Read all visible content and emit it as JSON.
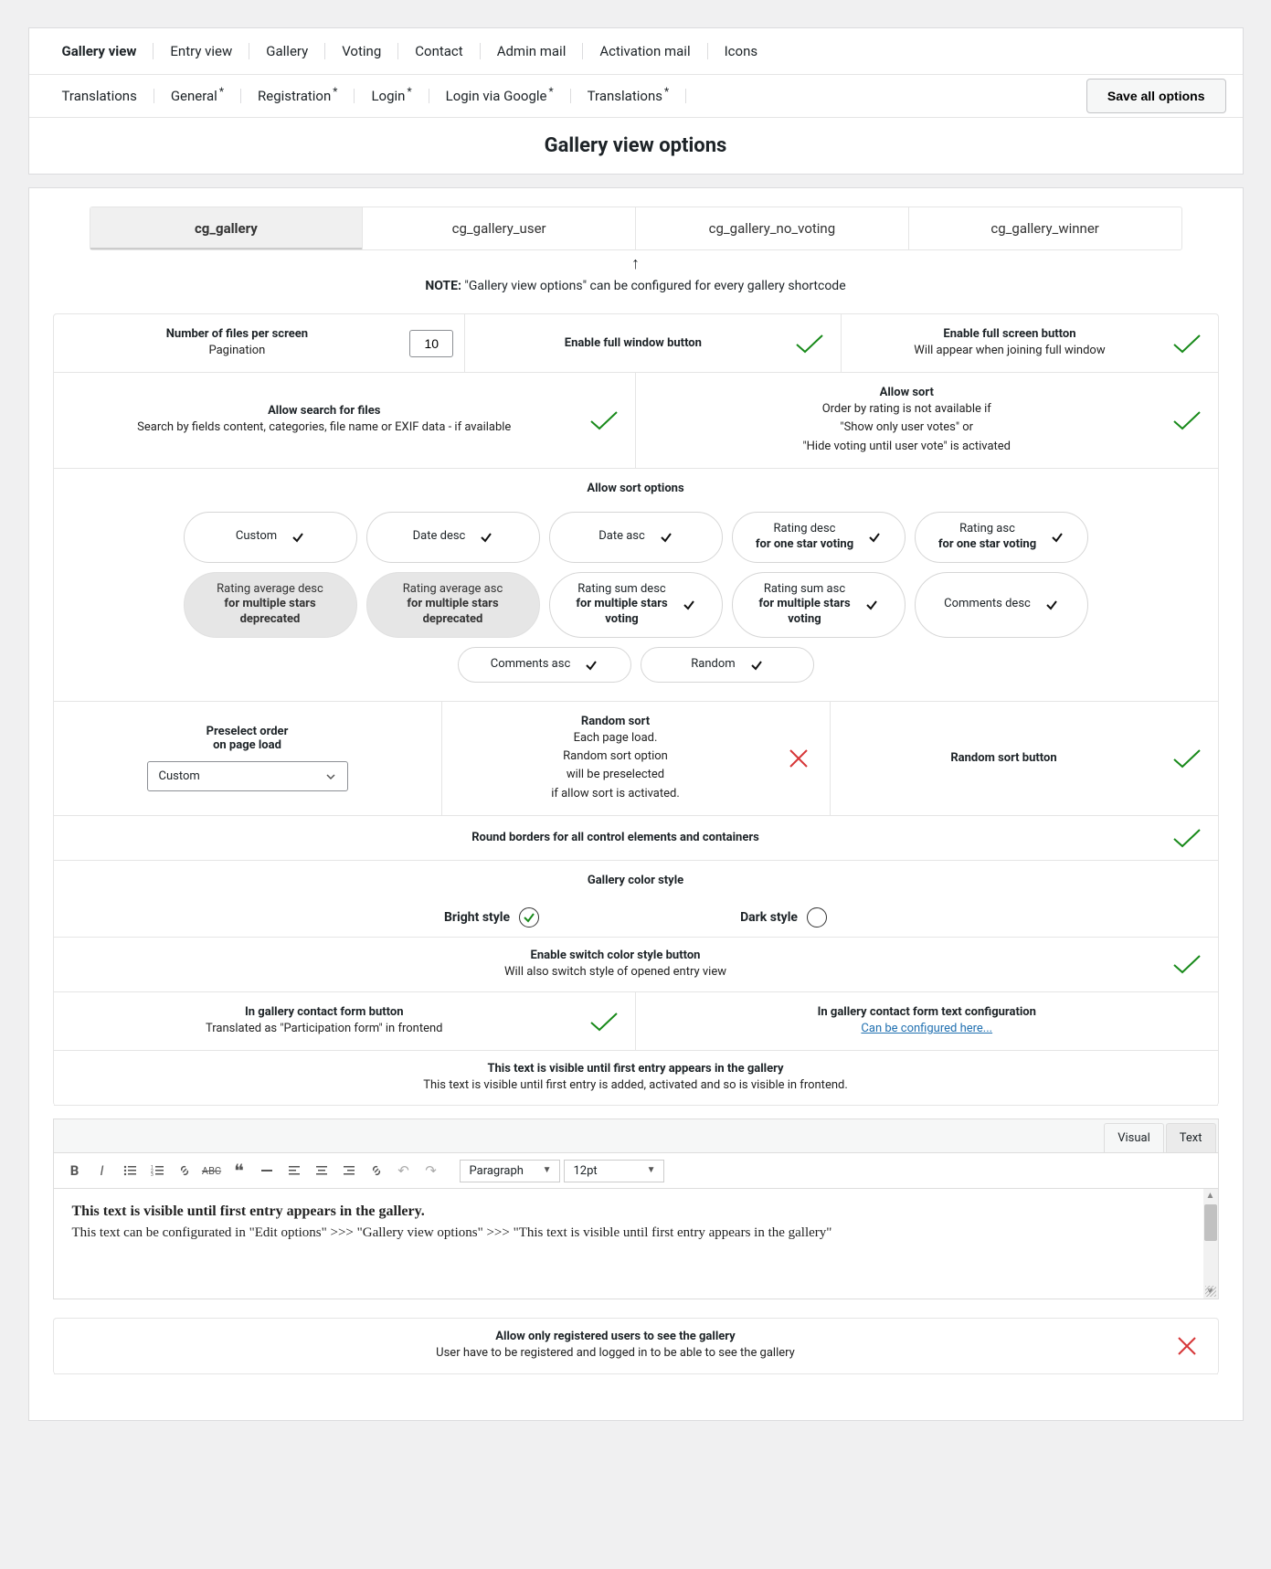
{
  "nav1": [
    "Gallery view",
    "Entry view",
    "Gallery",
    "Voting",
    "Contact",
    "Admin mail",
    "Activation mail",
    "Icons"
  ],
  "nav2": [
    "Translations",
    "General",
    "Registration",
    "Login",
    "Login via Google",
    "Translations"
  ],
  "nav2_starred": [
    false,
    true,
    true,
    true,
    true,
    true
  ],
  "save_all": "Save all options",
  "page_title": "Gallery view options",
  "shortcode_tabs": [
    "cg_gallery",
    "cg_gallery_user",
    "cg_gallery_no_voting",
    "cg_gallery_winner"
  ],
  "arrow": "↑",
  "note_bold": "NOTE:",
  "note_text": " \"Gallery view options\" can be configured for every gallery shortcode",
  "r1": {
    "files_per_screen": "Number of files per screen",
    "pagination": "Pagination",
    "value": "10",
    "full_window": "Enable full window button",
    "full_screen": "Enable full screen button",
    "full_screen_sub": "Will appear when joining full window"
  },
  "r2": {
    "search_lbl": "Allow search for files",
    "search_sub": "Search by fields content, categories, file name or EXIF data - if available",
    "sort_lbl": "Allow sort",
    "sort_sub1": "Order by rating is not available if",
    "sort_sub2": "\"Show only user votes\" or",
    "sort_sub3": "\"Hide voting until user vote\" is activated"
  },
  "sort_head": "Allow sort options",
  "pills": [
    {
      "l1": "Custom",
      "on": true
    },
    {
      "l1": "Date desc",
      "on": true
    },
    {
      "l1": "Date asc",
      "on": true
    },
    {
      "l1": "Rating desc",
      "l2": "for one star voting",
      "on": true
    },
    {
      "l1": "Rating asc",
      "l2": "for one star voting",
      "on": true
    },
    {
      "l1": "Rating average desc",
      "l2": "for multiple stars",
      "l3": "deprecated",
      "on": false
    },
    {
      "l1": "Rating average asc",
      "l2": "for multiple stars",
      "l3": "deprecated",
      "on": false
    },
    {
      "l1": "Rating sum desc",
      "l2": "for multiple stars",
      "l3": "voting",
      "on": true,
      "l2bold": true
    },
    {
      "l1": "Rating sum asc",
      "l2": "for multiple stars",
      "l3": "voting",
      "on": true,
      "l2bold": true
    },
    {
      "l1": "Comments desc",
      "on": true
    },
    {
      "l1": "Comments asc",
      "on": true
    },
    {
      "l1": "Random",
      "on": true
    }
  ],
  "r3": {
    "preselect1": "Preselect order",
    "preselect2": "on page load",
    "preselect_value": "Custom",
    "random_lbl": "Random sort",
    "random_s1": "Each page load.",
    "random_s2": "Random sort option",
    "random_s3": "will be preselected",
    "random_s4": "if allow sort is activated.",
    "random_btn": "Random sort button"
  },
  "round_borders": "Round borders for all control elements and containers",
  "color_style": "Gallery color style",
  "bright": "Bright style",
  "dark": "Dark style",
  "switch_lbl": "Enable switch color style button",
  "switch_sub": "Will also switch style of opened entry view",
  "contact_btn_lbl": "In gallery contact form button",
  "contact_btn_sub": "Translated as \"Participation form\" in frontend",
  "contact_cfg_lbl": "In gallery contact form text configuration",
  "contact_cfg_link": "Can be configured here...",
  "pretext_lbl": "This text is visible until first entry appears in the gallery",
  "pretext_sub": "This text is visible until first entry is added, activated and so is visible in frontend.",
  "editor": {
    "visual": "Visual",
    "text": "Text",
    "paragraph": "Paragraph",
    "fontsize": "12pt",
    "body_h": "This text is visible until first entry appears in the gallery.",
    "body_p": "This text can be configurated in \"Edit options\" >>> \"Gallery view options\" >>> \"This text is visible until first entry appears in the gallery\""
  },
  "reg_lbl": "Allow only registered users to see the gallery",
  "reg_sub": "User have to be registered and logged in to be able to see the gallery"
}
